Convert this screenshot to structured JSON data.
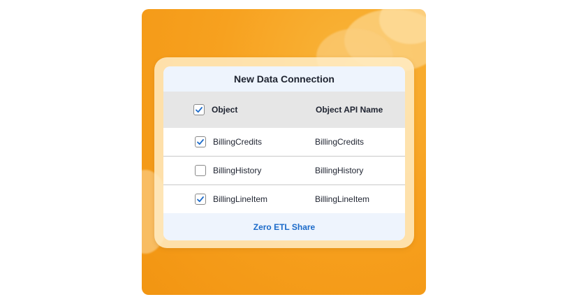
{
  "dialog": {
    "title": "New Data Connection",
    "columns": {
      "object": "Object",
      "api_name": "Object API Name"
    },
    "select_all_checked": true,
    "rows": [
      {
        "object": "BillingCredits",
        "api_name": "BillingCredits",
        "checked": true
      },
      {
        "object": "BillingHistory",
        "api_name": "BillingHistory",
        "checked": false
      },
      {
        "object": "BillingLineItem",
        "api_name": "BillingLineItem",
        "checked": true
      }
    ],
    "footer_link": "Zero ETL Share"
  },
  "colors": {
    "background_orange": "#f7a11f",
    "header_blue_tint": "#eef4fd",
    "column_header_gray": "#e6e6e6",
    "checkmark_blue": "#1b6ac9",
    "link_blue": "#1b6ac9"
  },
  "icons": {
    "checkmark": "checkmark-icon"
  }
}
